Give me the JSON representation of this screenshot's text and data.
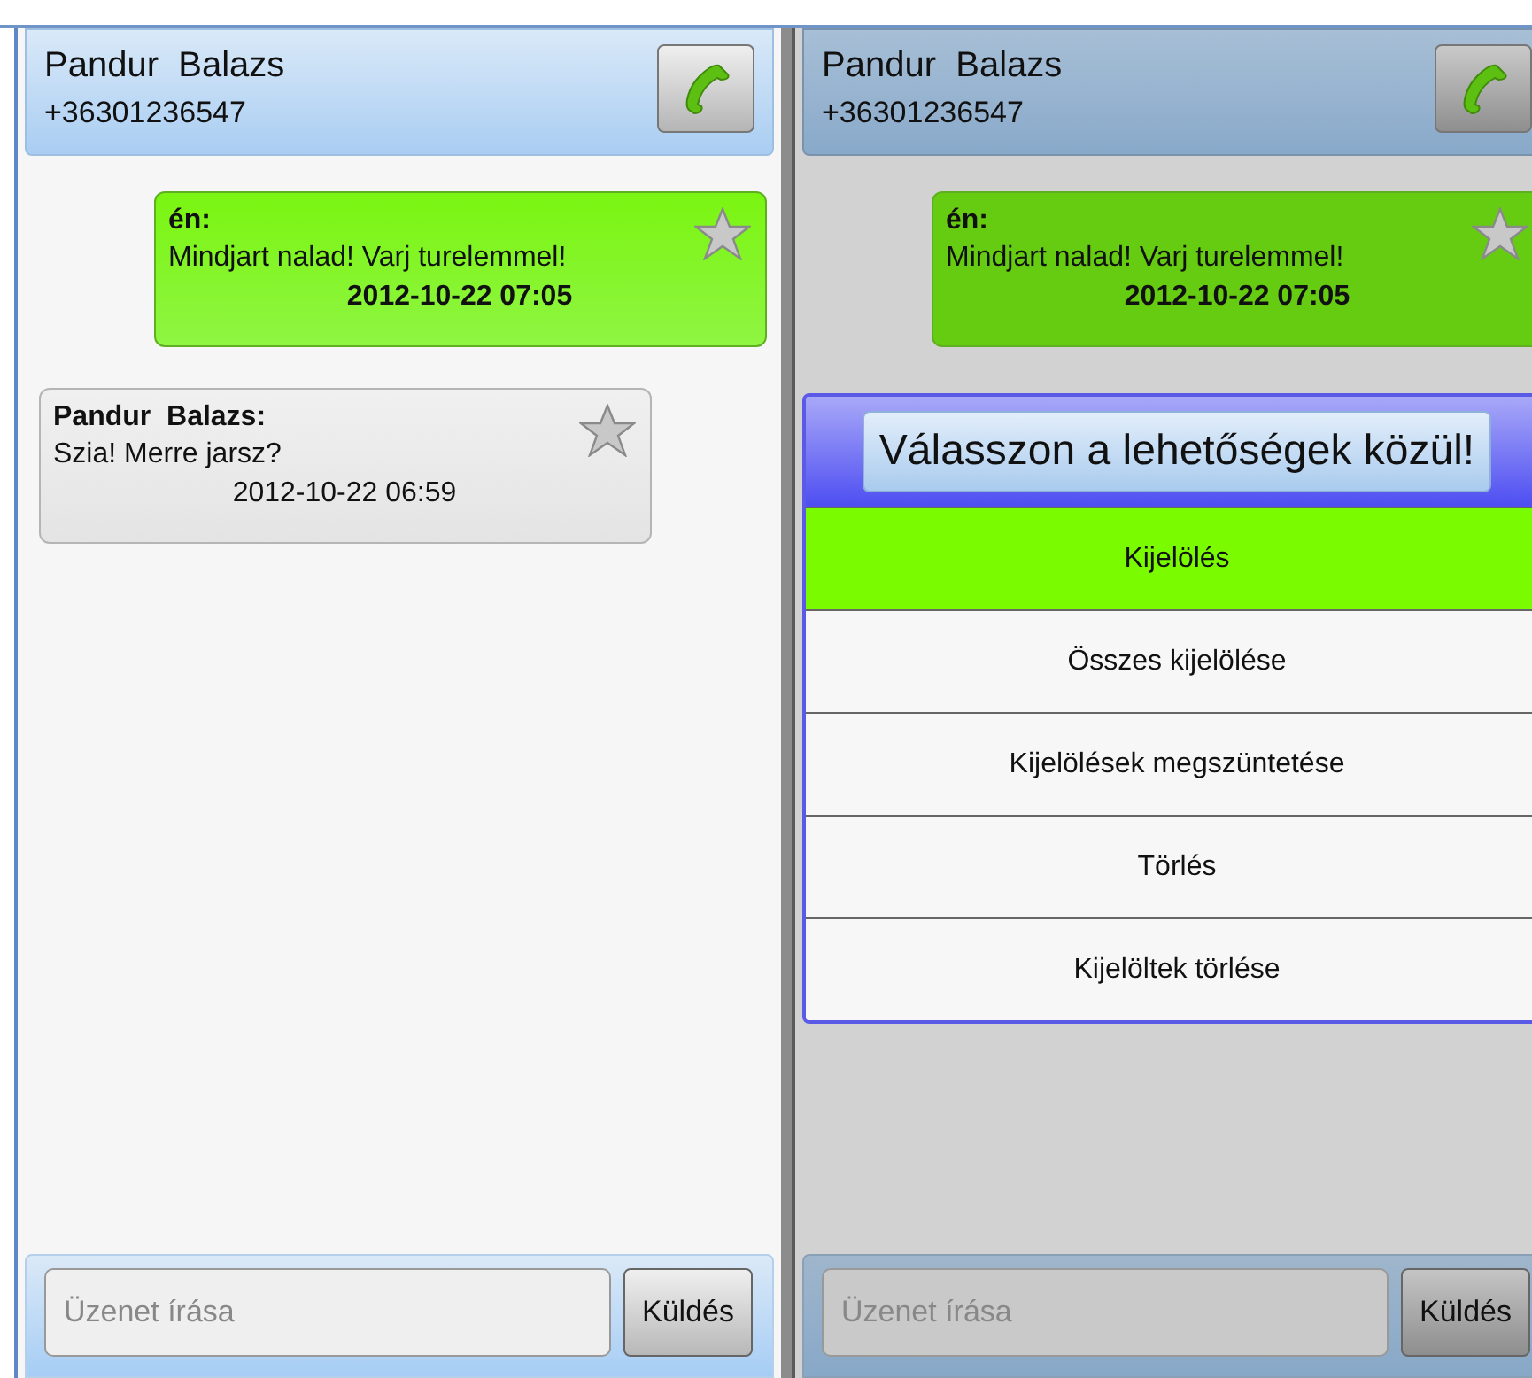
{
  "screens": [
    {
      "dimmed": false,
      "header": {
        "name": "Pandur  Balazs",
        "phone": "+36301236547"
      },
      "messages": [
        {
          "kind": "outgoing",
          "sender": "én:",
          "text": "Mindjart nalad! Varj turelemmel!",
          "time": "2012-10-22 07:05",
          "starred": false
        },
        {
          "kind": "incoming",
          "sender": "Pandur  Balazs:",
          "text": "Szia! Merre jarsz?",
          "time": "2012-10-22 06:59",
          "starred": false
        }
      ],
      "composer": {
        "placeholder": "Üzenet írása",
        "send": "Küldés"
      }
    },
    {
      "dimmed": true,
      "header": {
        "name": "Pandur  Balazs",
        "phone": "+36301236547"
      },
      "messages": [
        {
          "kind": "outgoing",
          "sender": "én:",
          "text": "Mindjart nalad! Varj turelemmel!",
          "time": "2012-10-22 07:05",
          "starred": false
        }
      ],
      "dialog": {
        "title": "Válasszon a lehetőségek közül!",
        "options": [
          {
            "label": "Kijelölés",
            "selected": true
          },
          {
            "label": "Összes kijelölése",
            "selected": false
          },
          {
            "label": "Kijelölések megszüntetése",
            "selected": false
          },
          {
            "label": "Törlés",
            "selected": false
          },
          {
            "label": "Kijelöltek törlése",
            "selected": false
          }
        ]
      },
      "composer": {
        "placeholder": "Üzenet írása",
        "send": "Küldés"
      }
    }
  ]
}
